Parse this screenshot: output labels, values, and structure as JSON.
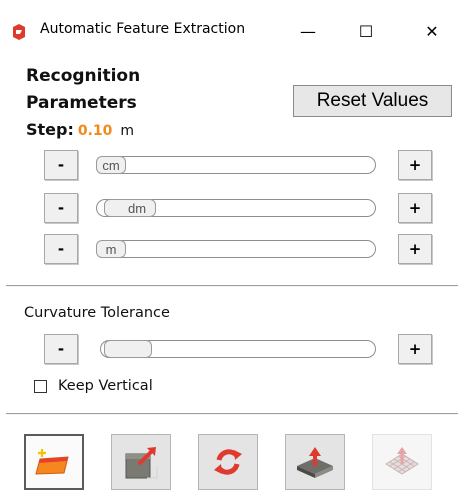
{
  "window": {
    "title": "Automatic Feature Extraction"
  },
  "window_controls": {
    "minimize": "—",
    "maximize": "☐",
    "close": "✕"
  },
  "recognition": {
    "heading_line1": "Recognition",
    "heading_line2": "Parameters",
    "step_label": "Step:",
    "step_value": "0.10",
    "step_unit": "m",
    "reset_label": "Reset Values"
  },
  "sliders": [
    {
      "unit": "cm",
      "minus": "-",
      "plus": "+"
    },
    {
      "unit": "dm",
      "minus": "-",
      "plus": "+"
    },
    {
      "unit": "m",
      "minus": "-",
      "plus": "+"
    }
  ],
  "curvature": {
    "label": "Curvature Tolerance",
    "minus": "-",
    "plus": "+"
  },
  "keep_vertical": {
    "label": "Keep Vertical",
    "checked": false
  },
  "colors": {
    "accent": "#f08a1c",
    "icon_red": "#e03a2e",
    "icon_orange": "#f5871f"
  },
  "toolbar": {
    "icons": [
      "new-face-icon",
      "extrude-icon",
      "refresh-icon",
      "raise-surface-icon",
      "grid-surface-icon"
    ]
  }
}
